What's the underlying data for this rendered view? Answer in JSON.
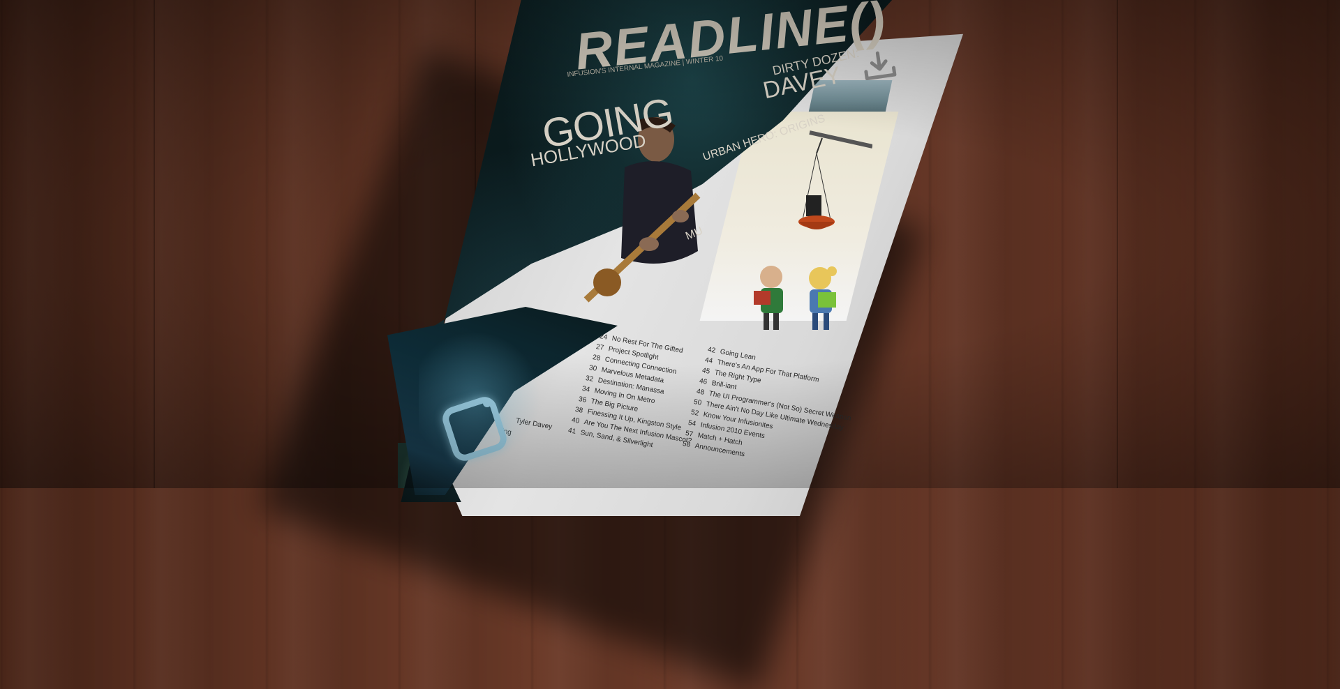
{
  "magazine": {
    "title": "READLINE()",
    "subtitle": "INFUSION'S INTERNAL MAGAZINE | WINTER 10",
    "headline_dirty": "DIRTY DOZEN:",
    "headline_davey": "DAVEY",
    "headline_going": "GOING",
    "headline_hollywood": "HOLLYWOOD",
    "headline_urban": "URBAN HERO: ORIGINS",
    "partial_word": "MU",
    "logo_letter": "i"
  },
  "toc_left": [
    {
      "num": "24",
      "label": "No Rest For The Gifted"
    },
    {
      "num": "27",
      "label": "Project Spotlight"
    },
    {
      "num": "28",
      "label": "Connecting Connection"
    },
    {
      "num": "30",
      "label": "Marvelous Metadata"
    },
    {
      "num": "32",
      "label": "Destination: Manassa"
    },
    {
      "num": "34",
      "label": "Moving In On Metro"
    },
    {
      "num": "36",
      "label": "The Big Picture"
    },
    {
      "num": "38",
      "label": "Finessing It Up, Kingston Style"
    },
    {
      "num": "40",
      "label": "Are You The Next Infusion Mascot?"
    },
    {
      "num": "41",
      "label": "Sun, Sand, & Silverlight"
    }
  ],
  "toc_right": [
    {
      "num": "42",
      "label": "Going Lean"
    },
    {
      "num": "44",
      "label": "There's An App For That Platform"
    },
    {
      "num": "45",
      "label": "The Right Type"
    },
    {
      "num": "46",
      "label": "Brill-iant"
    },
    {
      "num": "48",
      "label": "The UI Programmer's (Not So) Secret Weapon"
    },
    {
      "num": "50",
      "label": "There Ain't No Day Like Ultimate Wednesday"
    },
    {
      "num": "52",
      "label": "Know Your Infusionites"
    },
    {
      "num": "54",
      "label": "Infusion 2010 Events"
    },
    {
      "num": "57",
      "label": "Match + Hatch"
    },
    {
      "num": "58",
      "label": "Announcements"
    }
  ],
  "toc_partial": [
    {
      "label": "Tyler Davey"
    },
    {
      "label": "ning"
    }
  ],
  "icons": {
    "download": "download-icon"
  },
  "colors": {
    "wood": "#5e3222",
    "cover": "#081416",
    "title": "#d4cdbf",
    "accent": "#9fd4ea"
  }
}
